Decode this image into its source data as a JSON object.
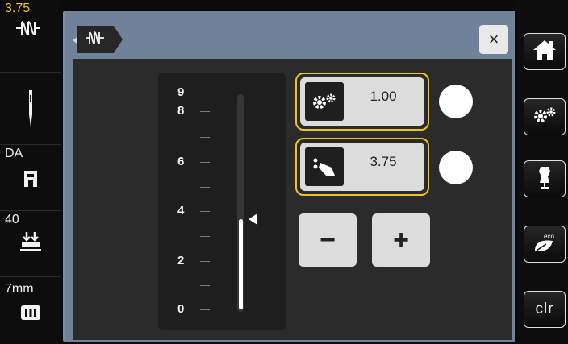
{
  "left_bar": {
    "stitch_width": "3.75",
    "presser_foot": "DA",
    "thread_tension": "40",
    "needle_plate": "7mm"
  },
  "panel": {
    "title_icon": "stitch-length-icon",
    "close_label": "×"
  },
  "scale": {
    "tick_labels": [
      "9",
      "8",
      "6",
      "4",
      "2",
      "0"
    ],
    "max": 9,
    "current_value": 3.75
  },
  "settings": {
    "default_icon": "gears-icon",
    "default_value": "1.00",
    "custom_icon": "touch-hand-icon",
    "custom_value": "3.75"
  },
  "buttons": {
    "minus_label": "−",
    "plus_label": "+"
  },
  "right_bar": {
    "home_icon": "home-icon",
    "settings_icon": "gears-icon",
    "tutorial_icon": "dress-form-icon",
    "eco_icon": "eco-leaf-icon",
    "clear_label": "clr"
  },
  "colors": {
    "accent": "#f0c419",
    "panel": "#6f8299",
    "content": "#2b2b2b"
  }
}
